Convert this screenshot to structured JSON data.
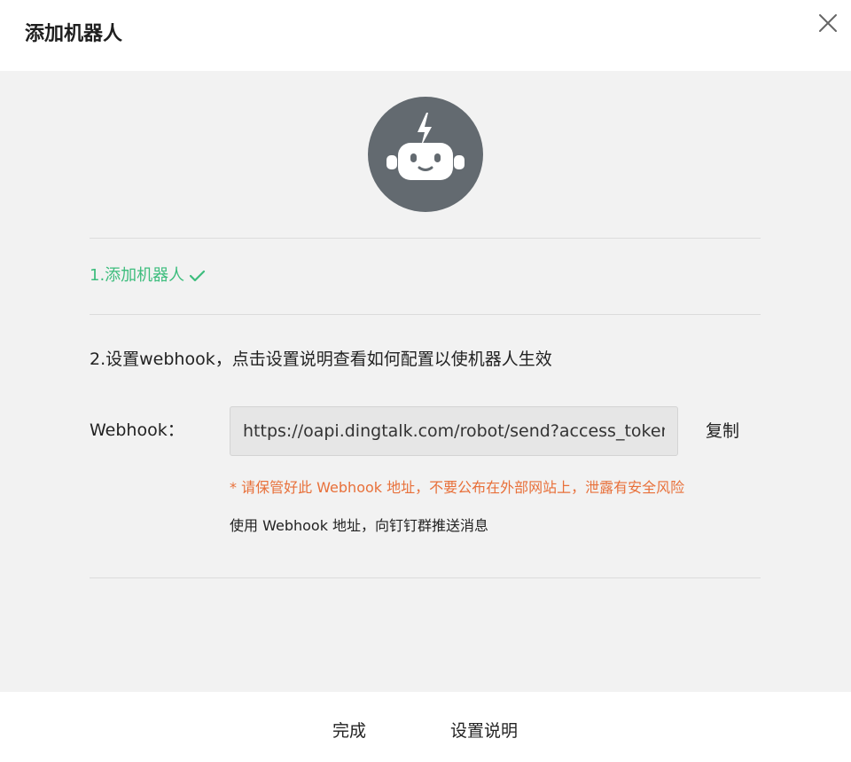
{
  "dialog": {
    "title": "添加机器人",
    "close_icon": "close-icon"
  },
  "robot": {
    "avatar_icon": "robot-icon",
    "avatar_bg": "#636a70"
  },
  "steps": {
    "step1_label": "1.添加机器人",
    "step1_icon": "check-icon",
    "step1_color": "#3dbd7d",
    "step2_label": "2.设置webhook，点击设置说明查看如何配置以使机器人生效"
  },
  "webhook": {
    "label": "Webhook：",
    "value": "https://oapi.dingtalk.com/robot/send?access_token=",
    "copy_label": "复制",
    "warning": "* 请保管好此 Webhook 地址，不要公布在外部网站上，泄露有安全风险",
    "warning_color": "#e8703a",
    "hint": "使用 Webhook 地址，向钉钉群推送消息"
  },
  "footer": {
    "done_label": "完成",
    "setup_label": "设置说明"
  }
}
